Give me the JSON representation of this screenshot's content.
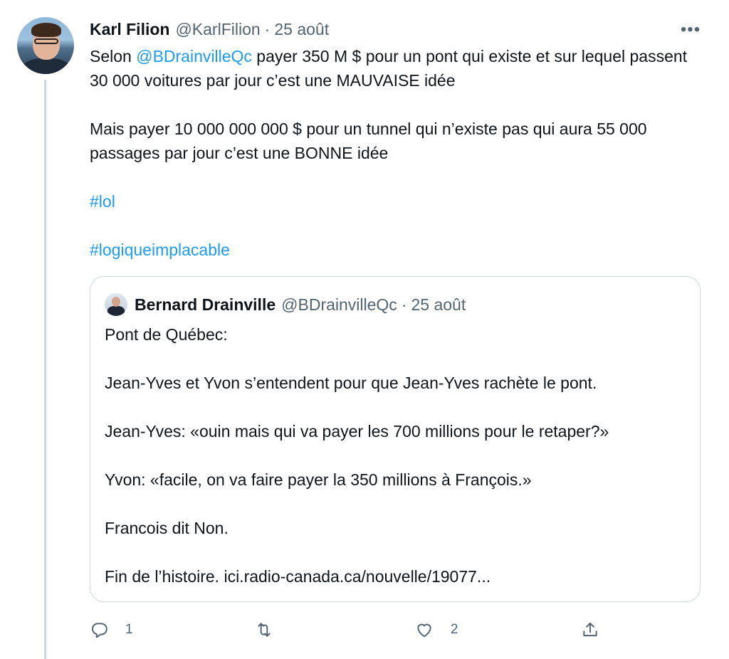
{
  "tweet": {
    "author_name": "Karl Filion",
    "author_handle": "@KarlFilion",
    "separator": "·",
    "date": "25 août",
    "more": "•••",
    "text": {
      "line1_before": "Selon ",
      "line1_mention": "@BDrainvilleQc",
      "line1_after": " payer 350 M $ pour un pont qui existe et sur lequel passent 30 000 voitures par jour c’est une MAUVAISE idée",
      "line2": "Mais payer 10 000 000 000 $ pour un tunnel qui n’existe pas qui aura 55 000 passages par jour c’est une BONNE idée",
      "hashtag1": "#lol",
      "hashtag2": "#logiqueimplacable"
    }
  },
  "quoted_tweet": {
    "author_name": "Bernard Drainville",
    "author_handle": "@BDrainvilleQc",
    "separator": "·",
    "date": "25 août",
    "paragraphs": [
      "Pont de Québec:",
      "Jean-Yves et Yvon s’entendent pour que Jean-Yves rachète le pont.",
      "Jean-Yves: «ouin mais qui va payer les 700 millions pour le retaper?»",
      "Yvon: «facile, on va faire payer la 350 millions à François.»",
      "Francois dit Non.",
      "Fin de l’histoire. ici.radio-canada.ca/nouvelle/19077..."
    ]
  },
  "actions": {
    "reply": {
      "icon": "reply-icon",
      "count": "1"
    },
    "retweet": {
      "icon": "retweet-icon",
      "count": ""
    },
    "like": {
      "icon": "heart-icon",
      "count": "2"
    },
    "share": {
      "icon": "share-icon",
      "count": ""
    }
  },
  "colors": {
    "link": "#1d9bf0",
    "muted": "#536471",
    "border": "#cfd9de",
    "text": "#0f1419"
  }
}
